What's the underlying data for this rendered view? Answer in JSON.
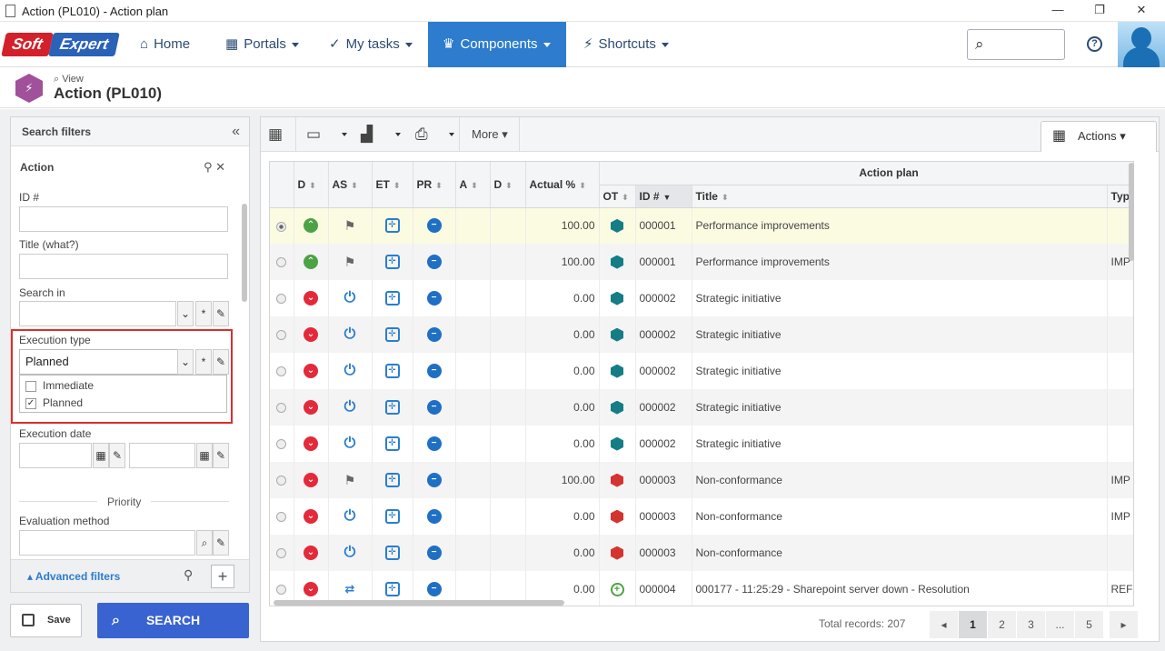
{
  "window": {
    "title": "Action (PL010) - Action plan",
    "minimize": "—",
    "restore": "❐",
    "close": "✕"
  },
  "brand": {
    "soft": "Soft",
    "expert": "Expert"
  },
  "nav": [
    {
      "label": "Home",
      "icon": "home-icon",
      "glyph": "⌂"
    },
    {
      "label": "Portals",
      "icon": "portals-icon",
      "glyph": "▦"
    },
    {
      "label": "My tasks",
      "icon": "check-icon",
      "glyph": "✓"
    },
    {
      "label": "Components",
      "icon": "trophy-icon",
      "glyph": "♛"
    },
    {
      "label": "Shortcuts",
      "icon": "bolt-icon",
      "glyph": "⚡"
    }
  ],
  "header": {
    "view_label": "View",
    "title": "Action (PL010)"
  },
  "filters": {
    "panel_title": "Search filters",
    "section": "Action",
    "id_label": "ID #",
    "title_label": "Title (what?)",
    "search_in_label": "Search in",
    "execution_type_label": "Execution type",
    "execution_type_value": "Planned",
    "options": [
      {
        "label": "Immediate",
        "checked": false
      },
      {
        "label": "Planned",
        "checked": true
      }
    ],
    "execution_date_label": "Execution date",
    "priority_label": "Priority",
    "evaluation_method_label": "Evaluation method",
    "advanced_label": "Advanced filters"
  },
  "buttons": {
    "save": "Save",
    "search": "SEARCH"
  },
  "toolbar": {
    "more": "More",
    "actions": "Actions"
  },
  "table": {
    "group_header": "Action plan",
    "columns": [
      "D",
      "AS",
      "ET",
      "PR",
      "A",
      "D",
      "Actual %",
      "OT",
      "ID #",
      "Title",
      "Type"
    ],
    "rows": [
      {
        "d": "up",
        "as": "flag",
        "actual": "100.00",
        "ot": "teal",
        "id": "000001",
        "title": "Performance improvements",
        "type": "",
        "state": "sel"
      },
      {
        "d": "up",
        "as": "flag",
        "actual": "100.00",
        "ot": "teal",
        "id": "000001",
        "title": "Performance improvements",
        "type": "IMP",
        "state": "alt"
      },
      {
        "d": "down",
        "as": "power",
        "actual": "0.00",
        "ot": "teal",
        "id": "000002",
        "title": "Strategic initiative",
        "type": "",
        "state": ""
      },
      {
        "d": "down",
        "as": "power",
        "actual": "0.00",
        "ot": "teal",
        "id": "000002",
        "title": "Strategic initiative",
        "type": "",
        "state": "alt"
      },
      {
        "d": "down",
        "as": "power",
        "actual": "0.00",
        "ot": "teal",
        "id": "000002",
        "title": "Strategic initiative",
        "type": "",
        "state": ""
      },
      {
        "d": "down",
        "as": "power",
        "actual": "0.00",
        "ot": "teal",
        "id": "000002",
        "title": "Strategic initiative",
        "type": "",
        "state": "alt"
      },
      {
        "d": "down",
        "as": "power",
        "actual": "0.00",
        "ot": "teal",
        "id": "000002",
        "title": "Strategic initiative",
        "type": "",
        "state": ""
      },
      {
        "d": "down",
        "as": "flag",
        "actual": "100.00",
        "ot": "red",
        "id": "000003",
        "title": "Non-conformance",
        "type": "IMP",
        "state": "alt"
      },
      {
        "d": "down",
        "as": "power",
        "actual": "0.00",
        "ot": "red",
        "id": "000003",
        "title": "Non-conformance",
        "type": "IMP",
        "state": ""
      },
      {
        "d": "down",
        "as": "power",
        "actual": "0.00",
        "ot": "red",
        "id": "000003",
        "title": "Non-conformance",
        "type": "",
        "state": "alt"
      },
      {
        "d": "down",
        "as": "swap",
        "actual": "0.00",
        "ot": "plus",
        "id": "000004",
        "title": "000177 - 11:25:29 - Sharepoint server down - Resolution",
        "type": "REF",
        "state": ""
      }
    ]
  },
  "footer": {
    "total": "Total records: 207",
    "pages": [
      "1",
      "2",
      "3",
      "...",
      "5"
    ],
    "current_page": "1"
  },
  "colors": {
    "accent": "#2d7ccd",
    "search_button": "#3a63d2",
    "highlight_border": "#d9302c",
    "selected_row": "#fbfbe2"
  }
}
